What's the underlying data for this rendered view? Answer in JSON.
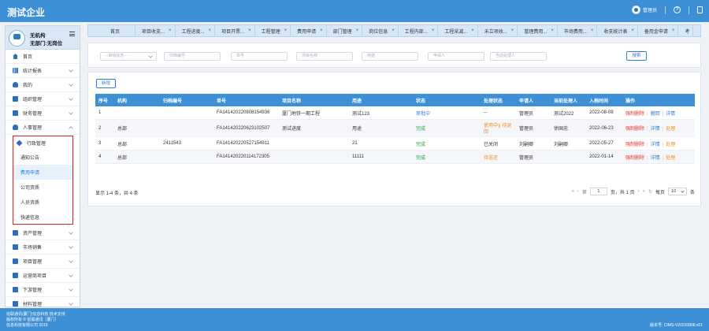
{
  "app": {
    "title": "测试企业",
    "admin_label": "管理员",
    "help_icon": "question-icon",
    "screen_icon": "fullscreen-icon"
  },
  "sidebar": {
    "org_name": "无机构",
    "org_dept": "无部门:无岗位",
    "items": [
      {
        "label": "首页",
        "icon": "home-icon"
      },
      {
        "label": "统计报表",
        "icon": "chart-icon"
      },
      {
        "label": "我的",
        "icon": "user-icon"
      },
      {
        "label": "组织管理",
        "icon": "org-icon"
      },
      {
        "label": "财务管理",
        "icon": "finance-icon"
      },
      {
        "label": "人事管理",
        "icon": "hr-icon"
      }
    ],
    "submenu": {
      "title": "行政管理",
      "items": [
        "通知公告",
        "费用申请",
        "公司资质",
        "人员资质",
        "快递信息"
      ],
      "active_index": 1
    },
    "items_after": [
      {
        "label": "资产管理",
        "icon": "asset-icon"
      },
      {
        "label": "市场销售",
        "icon": "market-icon"
      },
      {
        "label": "项目管理",
        "icon": "project-icon"
      },
      {
        "label": "运营商项目",
        "icon": "operator-icon"
      },
      {
        "label": "下游管理",
        "icon": "downstream-icon"
      },
      {
        "label": "材料管理",
        "icon": "material-icon"
      }
    ]
  },
  "tabs": [
    "首页",
    "项目收支...",
    "工程进度...",
    "项目开票...",
    "工程管理",
    "费用申请",
    "部门管理",
    "岗位信息",
    "工程内部...",
    "工程采减...",
    "未立项收...",
    "管理费用...",
    "市场费用...",
    "收支统计表",
    "备用金申请",
    "考"
  ],
  "search": {
    "fields": [
      "--审核状态--",
      "归档编号",
      "单号",
      "项目名称",
      "用途",
      "申请人",
      "当前处理人"
    ],
    "button": "搜索"
  },
  "main": {
    "new_button": "新增",
    "columns": [
      "序号",
      "机构",
      "归档编号",
      "单号",
      "项目名称",
      "用途",
      "状态",
      "处理状态",
      "申请人",
      "当前处理人",
      "入档时间",
      "操作"
    ],
    "rows": [
      {
        "no": "1",
        "org": "",
        "archive": "",
        "code": "FA141420220808154936",
        "project": "厦门地铁一期工程",
        "purpose": "测试123",
        "status": "审批中",
        "proc": "--",
        "applicant": "管理员",
        "handler": "测试2022",
        "date": "2022-08-08",
        "ops": [
          "强制删除",
          "撤回",
          "详情"
        ]
      },
      {
        "no": "2",
        "org": "总部",
        "archive": "",
        "code": "FA141420220623102507",
        "project": "测试进度",
        "purpose": "用途",
        "status": "完成",
        "proc": "使用中)| 待退回",
        "applicant": "管理员",
        "handler": "徐国忠",
        "date": "2022-06-23",
        "ops": [
          "强制删除",
          "详情",
          "处理"
        ]
      },
      {
        "no": "3",
        "org": "总部",
        "archive": "2411543",
        "code": "FA141420220527154911",
        "project": "",
        "purpose": "21",
        "status": "完成",
        "proc": "已关闭",
        "applicant": "刘嗣卿",
        "handler": "刘嗣卿",
        "date": "2022-05-27",
        "ops": [
          "强制删除",
          "详情",
          "处理"
        ]
      },
      {
        "no": "4",
        "org": "总部",
        "archive": "",
        "code": "FA141420220114172305",
        "project": "",
        "purpose": "11111",
        "status": "完成",
        "proc": "待送还",
        "applicant": "管理员",
        "handler": "",
        "date": "2022-01-14",
        "ops": [
          "强制删除",
          "详情",
          "处理"
        ]
      }
    ],
    "pager": {
      "info": "显示 1-4 条，共 4 条",
      "page": "1",
      "page_suffix": "页，共 1 页",
      "per_label": "每页",
      "per_value": "10",
      "per_suffix": "条"
    }
  },
  "footer": {
    "line1": "信联通讯(厦门)信息科技 技术支持",
    "line2": "版权所有 © 信联通讯（厦门）",
    "line3": "信息科技有限公司 2019",
    "version": "版本号: CIMS-V20220808.v01"
  }
}
